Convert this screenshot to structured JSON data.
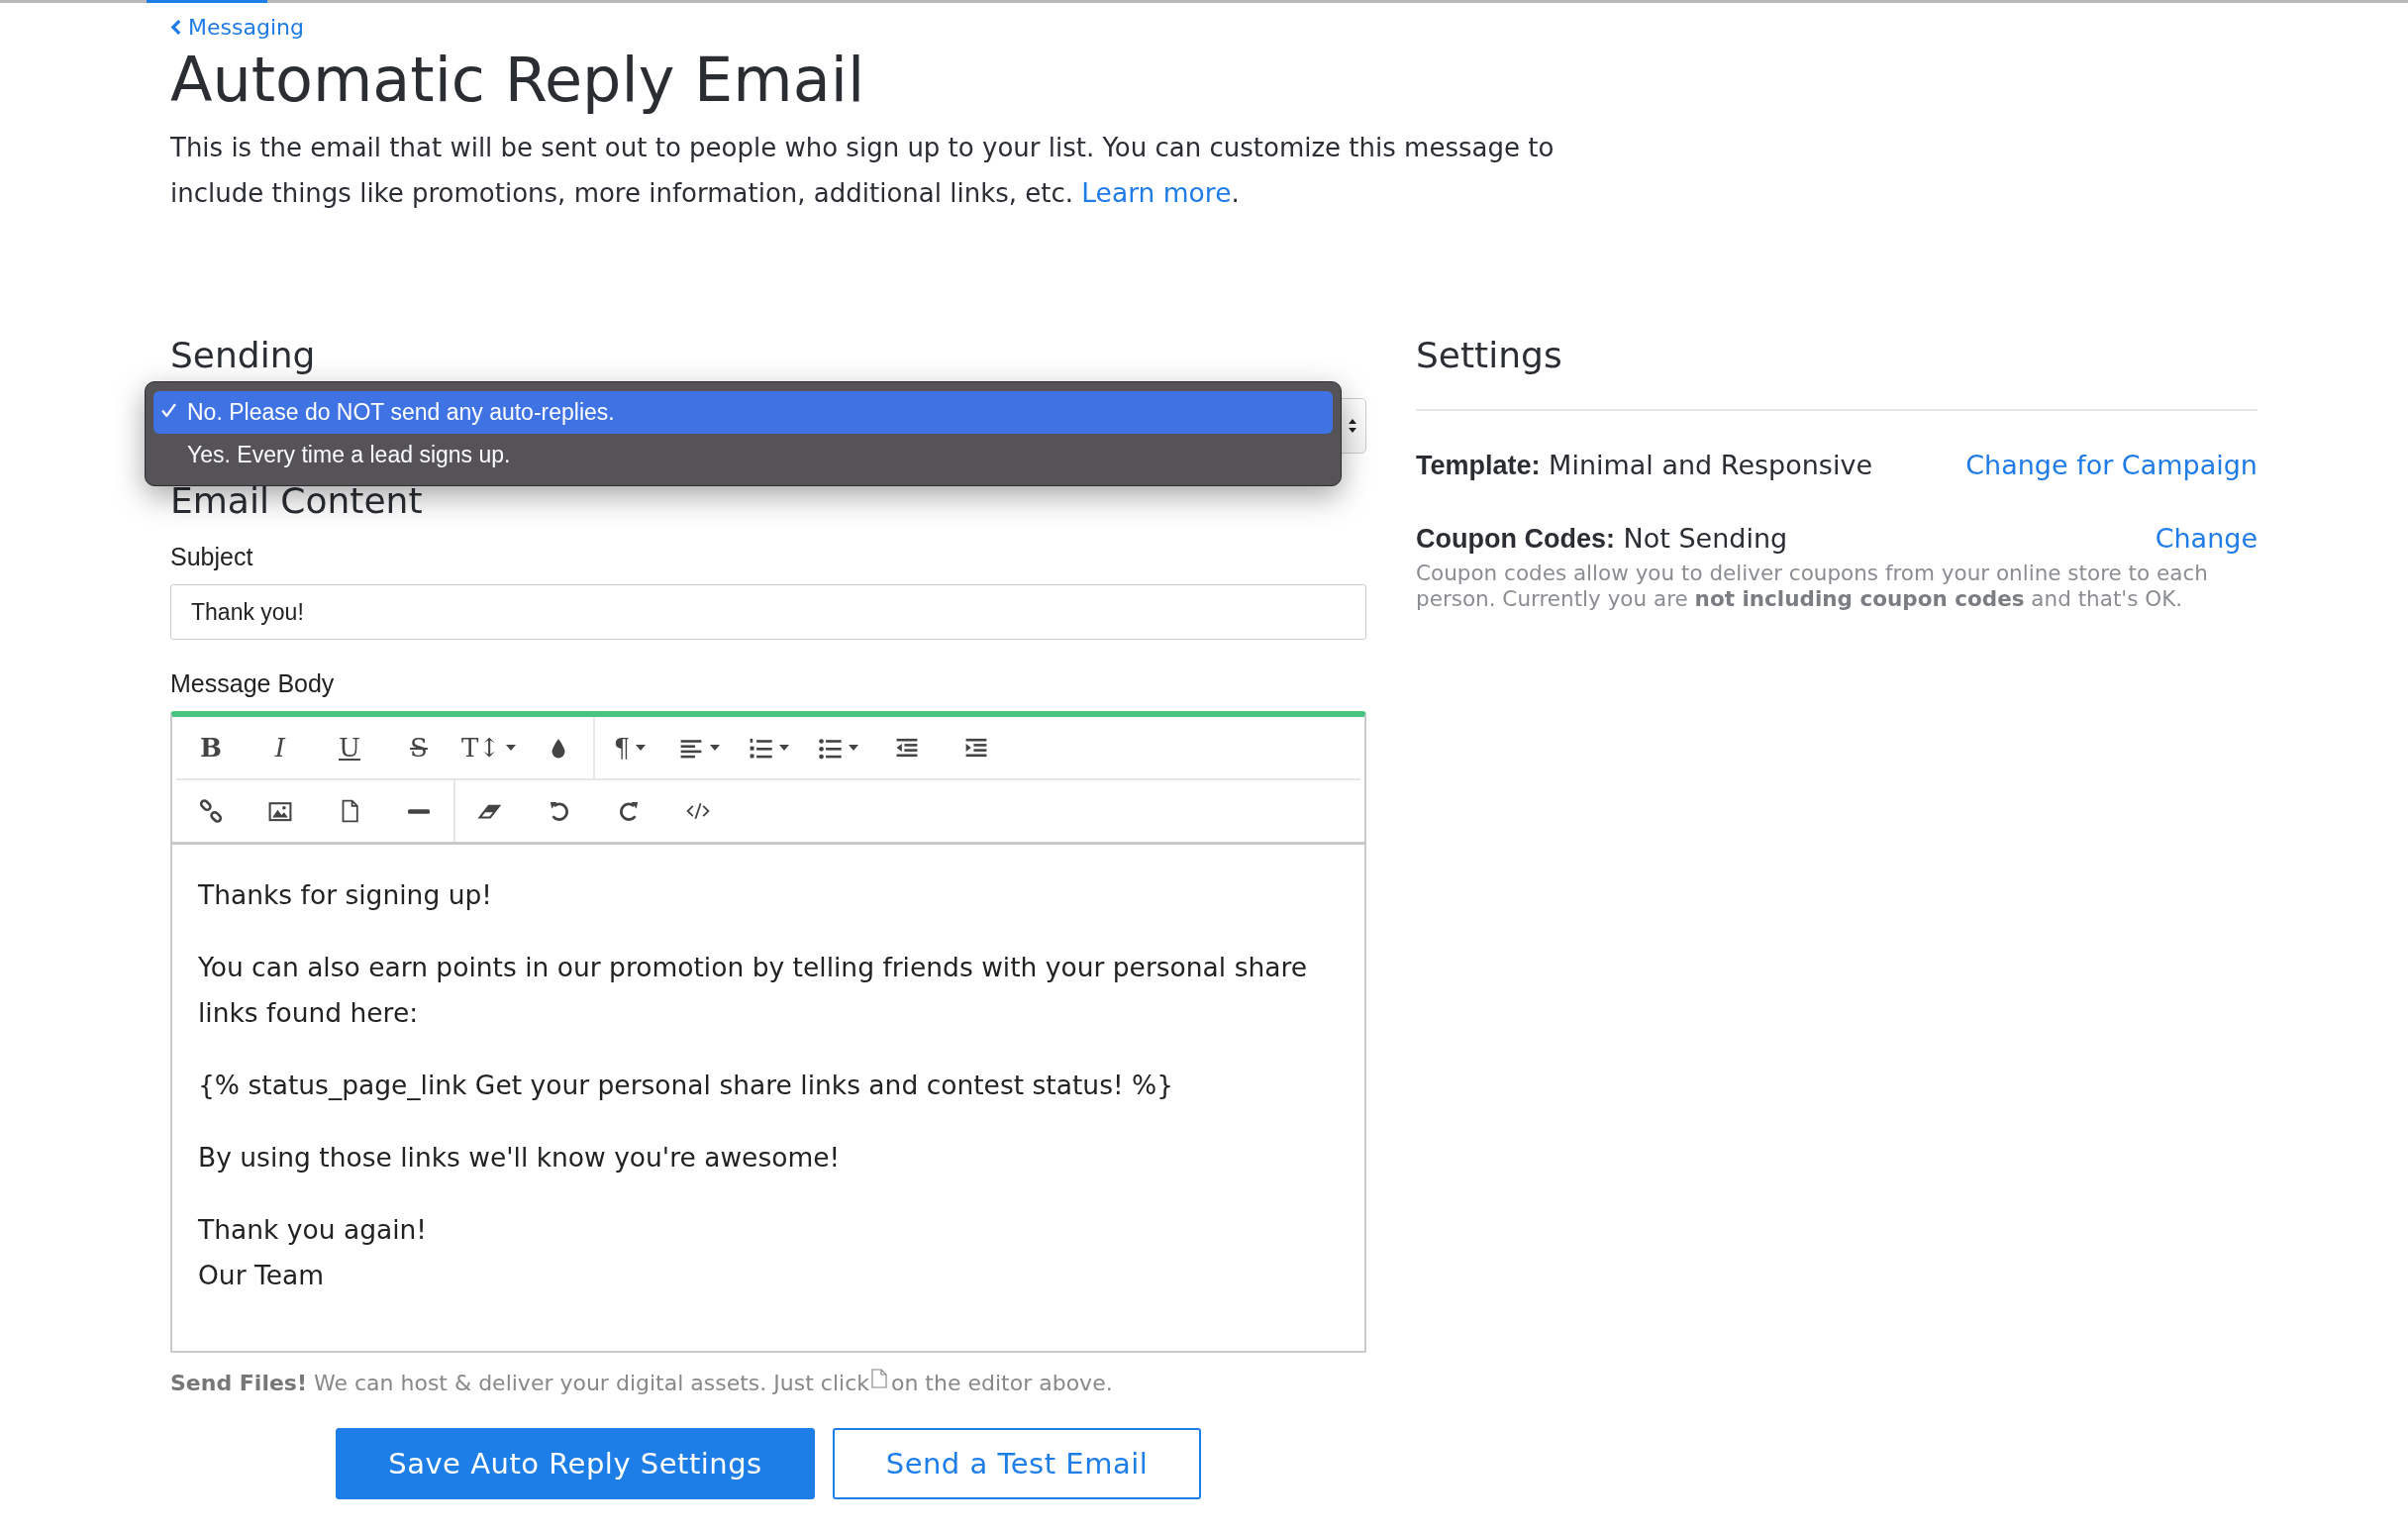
{
  "nav": {
    "back_link": "Messaging"
  },
  "title": "Automatic Reply Email",
  "intro": {
    "text": "This is the email that will be sent out to people who sign up to your list. You can customize this message to include things like promotions, more information, additional links, etc.",
    "link": "Learn more",
    "trailing": "."
  },
  "sending": {
    "heading": "Sending",
    "expanded": true,
    "options": [
      {
        "label": "No. Please do NOT send any auto-replies.",
        "selected": true
      },
      {
        "label": "Yes. Every time a lead signs up.",
        "selected": false
      }
    ]
  },
  "email_content": {
    "heading": "Email Content",
    "subject": {
      "label": "Subject",
      "value": "Thank you!"
    },
    "message_body": {
      "label": "Message Body",
      "toolbar": [
        [
          [
            {
              "kind": "bold",
              "label": "B",
              "dropdown": false
            },
            {
              "kind": "italic",
              "label": "I",
              "dropdown": false
            },
            {
              "kind": "underline",
              "label": "U",
              "dropdown": false
            },
            {
              "kind": "strikethrough",
              "label": "S",
              "dropdown": false
            },
            {
              "kind": "font-size",
              "label": "T↕",
              "dropdown": true
            },
            {
              "kind": "color",
              "dropdown": false
            }
          ],
          [
            {
              "kind": "paragraph",
              "label": "¶",
              "dropdown": true
            },
            {
              "kind": "align",
              "dropdown": true
            },
            {
              "kind": "ordered-list",
              "dropdown": true
            },
            {
              "kind": "unordered-list",
              "dropdown": true
            },
            {
              "kind": "outdent",
              "dropdown": false
            },
            {
              "kind": "indent",
              "dropdown": false
            }
          ]
        ],
        [
          [
            {
              "kind": "link",
              "dropdown": false
            },
            {
              "kind": "image",
              "dropdown": false
            },
            {
              "kind": "file",
              "dropdown": false
            },
            {
              "kind": "rule",
              "dropdown": false
            }
          ],
          [
            {
              "kind": "eraser",
              "dropdown": false
            },
            {
              "kind": "undo",
              "dropdown": false
            },
            {
              "kind": "redo",
              "dropdown": false
            },
            {
              "kind": "code",
              "dropdown": false
            }
          ]
        ]
      ],
      "paragraphs": [
        [
          "Thanks for signing up!"
        ],
        [
          "You can also earn points in our promotion by telling friends with your personal share links found here:"
        ],
        [
          "{% status_page_link Get your personal share links and contest status! %}"
        ],
        [
          "By using those links we'll know you're awesome!"
        ],
        [
          "Thank you again!",
          "Our Team"
        ]
      ]
    }
  },
  "send_files_note": {
    "before": "**Send Files!** We can host & deliver your digital assets. Just click",
    "after": "on the editor above."
  },
  "buttons": [
    {
      "label": "Save Auto Reply Settings",
      "kind": "primary"
    },
    {
      "label": "Send a Test Email",
      "kind": "secondary"
    }
  ],
  "settings": {
    "heading": "Settings",
    "rows": [
      {
        "label": "Template:",
        "value": "Minimal and Responsive",
        "action": "Change for Campaign"
      },
      {
        "label": "Coupon Codes:",
        "value": "Not Sending",
        "action": "Change",
        "description": "Coupon codes allow you to deliver coupons from your online store to each person. Currently you are **not including coupon codes** and that's OK."
      }
    ]
  }
}
